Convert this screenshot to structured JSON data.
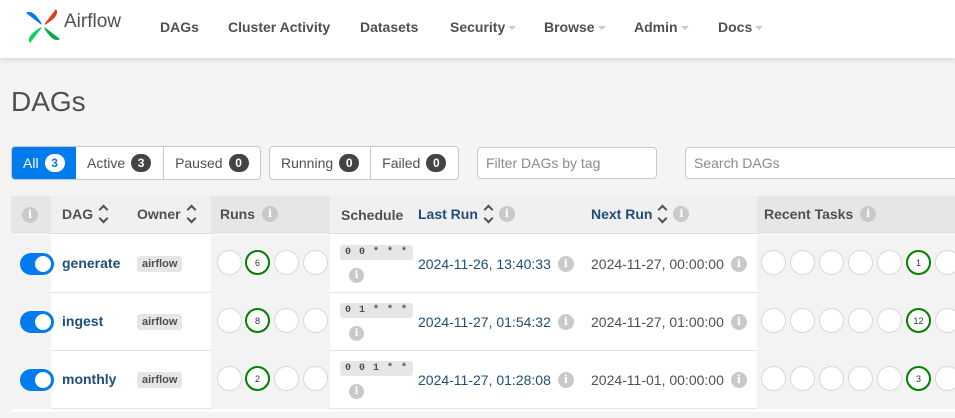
{
  "app": {
    "name": "Airflow"
  },
  "nav": [
    {
      "label": "DAGs",
      "dropdown": false
    },
    {
      "label": "Cluster Activity",
      "dropdown": false
    },
    {
      "label": "Datasets",
      "dropdown": false
    },
    {
      "label": "Security",
      "dropdown": true
    },
    {
      "label": "Browse",
      "dropdown": true
    },
    {
      "label": "Admin",
      "dropdown": true
    },
    {
      "label": "Docs",
      "dropdown": true
    }
  ],
  "page_title": "DAGs",
  "status_filters": [
    {
      "label": "All",
      "count": "3",
      "active": true
    },
    {
      "label": "Active",
      "count": "3",
      "active": false
    },
    {
      "label": "Paused",
      "count": "0",
      "active": false
    }
  ],
  "run_filters": [
    {
      "label": "Running",
      "count": "0"
    },
    {
      "label": "Failed",
      "count": "0"
    }
  ],
  "tag_filter": {
    "placeholder": "Filter DAGs by tag",
    "value": ""
  },
  "search": {
    "placeholder": "Search DAGs",
    "value": ""
  },
  "info_glyph": "i",
  "table": {
    "headers": {
      "dag": "DAG",
      "owner": "Owner",
      "runs": "Runs",
      "schedule": "Schedule",
      "last_run": "Last Run",
      "next_run": "Next Run",
      "recent_tasks": "Recent Tasks"
    },
    "rows": [
      {
        "dag_id": "generate",
        "owner": "airflow",
        "paused": false,
        "runs": [
          "",
          "6",
          "",
          ""
        ],
        "schedule": "0 0 * * *",
        "last_run": "2024-11-26, 13:40:33",
        "next_run": "2024-11-27, 00:00:00",
        "recent_tasks": [
          "",
          "",
          "",
          "",
          "",
          "1",
          ""
        ]
      },
      {
        "dag_id": "ingest",
        "owner": "airflow",
        "paused": false,
        "runs": [
          "",
          "8",
          "",
          ""
        ],
        "schedule": "0 1 * * *",
        "last_run": "2024-11-27, 01:54:32",
        "next_run": "2024-11-27, 01:00:00",
        "recent_tasks": [
          "",
          "",
          "",
          "",
          "",
          "12",
          ""
        ]
      },
      {
        "dag_id": "monthly",
        "owner": "airflow",
        "paused": false,
        "runs": [
          "",
          "2",
          "",
          ""
        ],
        "schedule": "0 0 1 * *",
        "last_run": "2024-11-27, 01:28:08",
        "next_run": "2024-11-01, 00:00:00",
        "recent_tasks": [
          "",
          "",
          "",
          "",
          "",
          "3",
          ""
        ]
      }
    ]
  },
  "colors": {
    "accent": "#017cee",
    "success": "#008000",
    "link": "#1f4e79",
    "text": "#51504f"
  }
}
